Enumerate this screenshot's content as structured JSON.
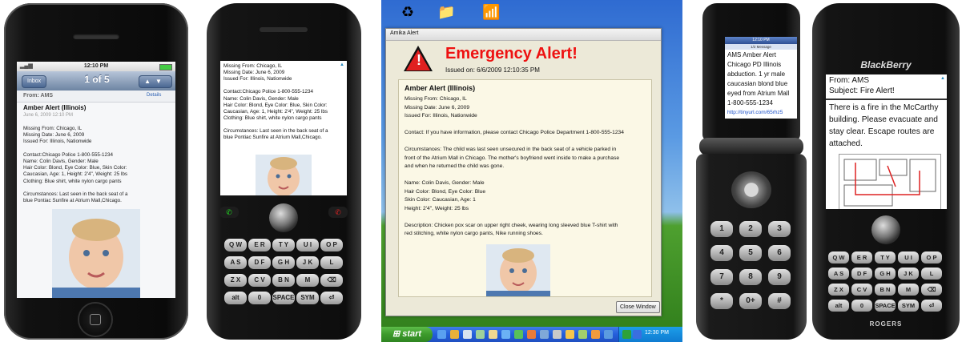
{
  "iphone": {
    "status_time": "12:10 PM",
    "inbox_label": "Inbox",
    "count": "1 of 5",
    "from": "From: AMS",
    "details_label": "Details",
    "title": "Amber Alert (Illinois)",
    "date": "June 6, 2009 12:10 PM",
    "lines": [
      "Missing From: Chicago, IL",
      "Missing Date: June 6, 2009",
      "Issued For: Illinois, Nationwide",
      "",
      "Contact:Chicago Police 1-800-555-1234",
      "Name: Colin Davis, Gender: Male",
      "Hair Color: Blond, Eye Color: Blue, Skin Color:",
      "Caucasian, Age: 1, Height: 2'4\", Weight: 25 lbs",
      "Clothing: Blue shirt, white nylon cargo pants",
      "",
      "Circumstances: Last seen in the back seat of a",
      "blue Pontiac Sunfire at Atrium Mall,Chicago."
    ]
  },
  "pearl": {
    "lines": [
      "Missing From: Chicago, IL",
      "Missing Date: June 6, 2009",
      "Issued For: Illinois, Nationwide",
      "",
      "Contact:Chicago Police 1-800-555-1234",
      "Name: Colin Davis, Gender: Male",
      "Hair Color: Blond, Eye Color: Blue, Skin Color:",
      "Caucasian, Age: 1, Height: 2'4\", Weight: 25 lbs",
      "Clothing: Blue shirt, white nylon cargo pants",
      "",
      "Circumstances: Last seen in the back seat of a",
      "blue Pontiac Sunfire at Atrium Mall,Chicago."
    ],
    "keys": [
      [
        "Q W",
        "E R",
        "T Y",
        "U I",
        "O P"
      ],
      [
        "A S",
        "D F",
        "G H",
        "J K",
        "L"
      ],
      [
        "Z X",
        "C V",
        "B N",
        "M",
        "⌫"
      ],
      [
        "alt",
        "0",
        "SPACE",
        "SYM",
        "⏎"
      ]
    ]
  },
  "desktop": {
    "window_title": "Amika Alert",
    "heading": "Emergency Alert!",
    "issued": "Issued on: 6/6/2009 12:10:35 PM",
    "panel_title": "Amber Alert (Illinois)",
    "panel_lines": [
      "Missing From: Chicago, IL",
      "Missing Date: June 6, 2009",
      "Issued For: Illinois, Nationwide",
      "",
      "Contact: If you have information, please contact Chicago Police Department 1-800-555-1234",
      "",
      "Circumstances: The child was last seen unsecured in the back seat of a vehicle parked in",
      "front of the Atrium Mall in Chicago. The mother's boyfriend went inside to make a purchase",
      "and when he returned the child was gone.",
      "",
      "Name: Colin Davis, Gender: Male",
      "Hair Color: Blond, Eye Color: Blue",
      "Skin Color: Caucasian, Age: 1",
      "Height: 2'4\", Weight: 25 lbs",
      "",
      "Description: Chicken pox scar on upper right cheek, wearing long sleeved blue T-shirt with",
      "red stitching, white nylon cargo pants, Nike running shoes."
    ],
    "close_label": "Close Window",
    "start_label": "start",
    "clock": "12:30 PM"
  },
  "flip": {
    "title_bar": "12:10 PM",
    "sub_bar": "1/2 Message",
    "lines": [
      "AMS Amber Alert",
      "Chicago PD Illinois",
      "abduction. 1 yr male",
      "caucasian  blond blue",
      "eyed from Atrium Mall",
      "1-800-555-1234"
    ],
    "link": "http://tinyurl.com/65rhz5",
    "keys": [
      "1",
      "2",
      "3",
      "4",
      "5",
      "6",
      "7",
      "8",
      "9",
      "*",
      "0+",
      "#"
    ]
  },
  "blackberry": {
    "logo": "BlackBerry",
    "from": "From: AMS",
    "subject": "Subject: Fire Alert!",
    "body_lines": [
      "There is a fire in the McCarthy",
      "building. Please evacuate and",
      "stay clear. Escape routes are",
      "attached."
    ],
    "brand": "ROGERS"
  },
  "colors": {
    "alert_red": "#e11111",
    "panel_bg": "#fbf8e6",
    "xp_blue": "#245edb",
    "start_green": "#3c9a2b"
  }
}
